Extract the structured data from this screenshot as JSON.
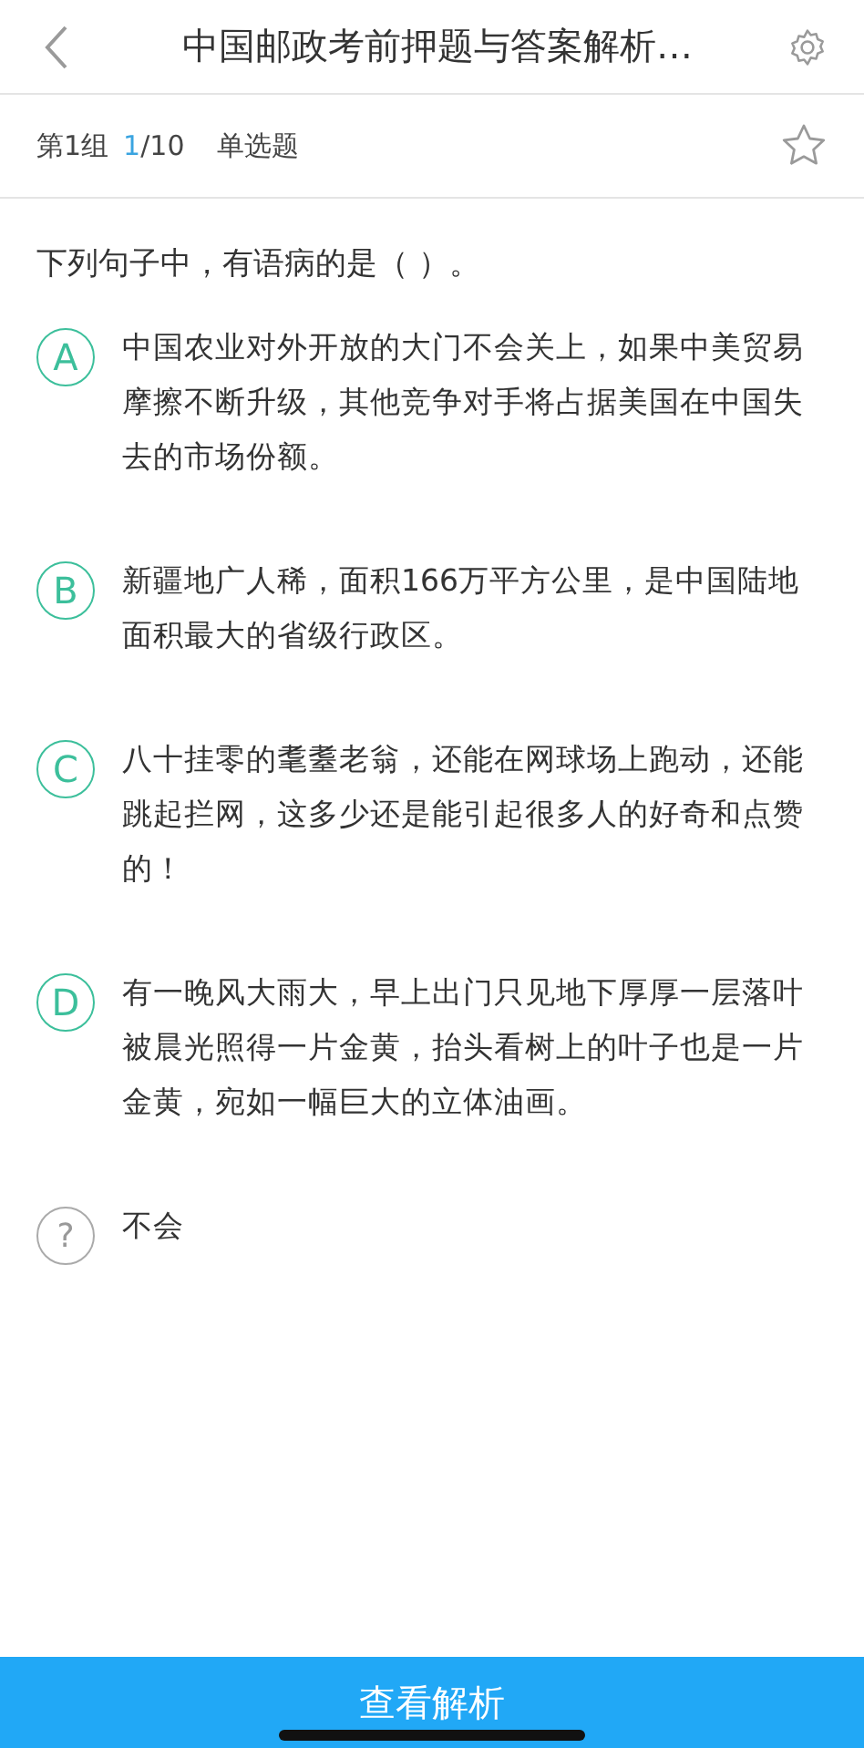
{
  "header": {
    "title": "中国邮政考前押题与答案解析…"
  },
  "info": {
    "group": "第1组",
    "current": "1",
    "total": "/10",
    "type": "单选题",
    "starred": false
  },
  "question": "下列句子中，有语病的是（ ）。",
  "options": [
    {
      "kind": "letter",
      "label": "A",
      "text": "中国农业对外开放的大门不会关上，如果中美贸易摩擦不断升级，其他竞争对手将占据美国在中国失去的市场份额。"
    },
    {
      "kind": "letter",
      "label": "B",
      "text": "新疆地广人稀，面积166万平方公里，是中国陆地面积最大的省级行政区。"
    },
    {
      "kind": "letter",
      "label": "C",
      "text": "八十挂零的耄耋老翁，还能在网球场上跑动，还能跳起拦网，这多少还是能引起很多人的好奇和点赞的！"
    },
    {
      "kind": "letter",
      "label": "D",
      "text": "有一晚风大雨大，早上出门只见地下厚厚一层落叶被晨光照得一片金黄，抬头看树上的叶子也是一片金黄，宛如一幅巨大的立体油画。"
    },
    {
      "kind": "unknown",
      "label": "?",
      "text": "不会"
    }
  ],
  "footer": {
    "button": "查看解析"
  }
}
